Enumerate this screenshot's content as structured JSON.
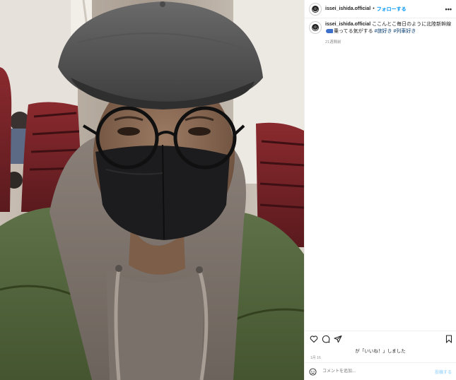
{
  "post": {
    "username": "issei_ishida.official",
    "separator": "•",
    "follow_label": "フォローする",
    "more_label": "•••",
    "caption": {
      "username": "issei_ishida.official",
      "text_before": "ここんとこ毎日のように北陸新幹線",
      "text_after": "乗ってる気がする",
      "hashtags": [
        "#旅好き",
        "#列車好き"
      ]
    },
    "time_ago": "21週間前",
    "likes_text": "が「いいね！」しました",
    "date": "1月 16",
    "comment_placeholder": "コメントを追加...",
    "post_button": "投稿する"
  },
  "icons": {
    "like": "heart-icon",
    "comment": "comment-icon",
    "share": "share-icon",
    "save": "bookmark-icon",
    "emoji": "smiley-icon",
    "caption_emoji": "bullet-train-emoji"
  },
  "colors": {
    "accent": "#0095f6",
    "hashtag": "#00376b",
    "muted": "#8e8e8e",
    "text": "#262626",
    "post_button_disabled": "#b2dffc"
  }
}
